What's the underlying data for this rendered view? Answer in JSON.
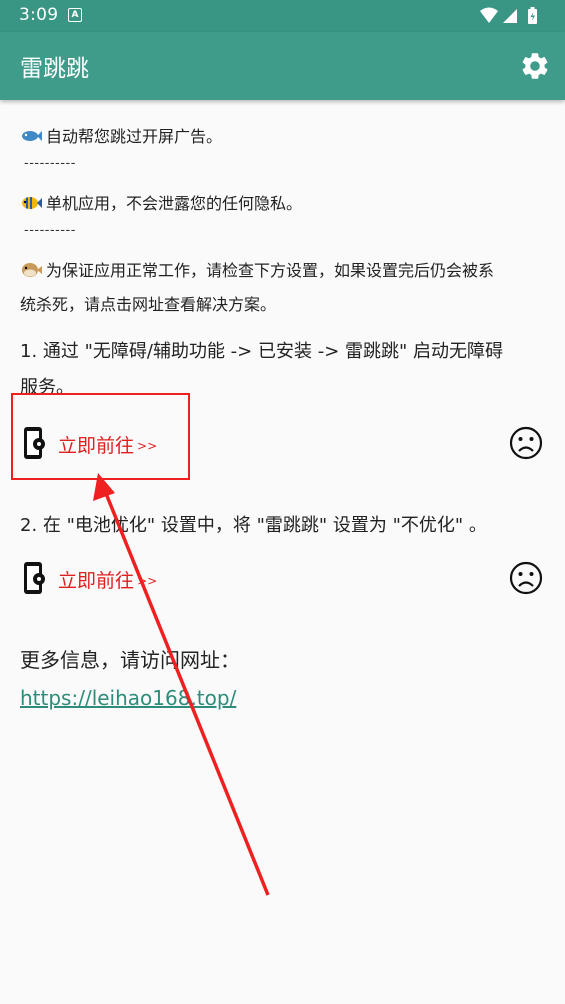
{
  "status_bar": {
    "time": "3:09",
    "notification_icon": "A"
  },
  "app_bar": {
    "title": "雷跳跳",
    "settings_icon": "gear-icon",
    "background_color": "#3f9c8a"
  },
  "intro": {
    "line1": "自动帮您跳过开屏广告。",
    "separator1": "----------",
    "line2": "单机应用，不会泄露您的任何隐私。",
    "separator2": "----------",
    "line3_part1": "为保证应用正常工作，请检查下方设置，如果设置完后仍会被系",
    "line3_part2": "统杀死，请点击网址查看解决方案。"
  },
  "steps": [
    {
      "text_line1": "1. 通过 \"无障碍/辅助功能 -> 已安装 -> 雷跳跳\" 启动无障碍",
      "text_line2": "服务。",
      "action_label": "立即前往",
      "action_arrows": ">>",
      "status_icon": "sad-face-icon"
    },
    {
      "text_line1": "2. 在 \"电池优化\" 设置中，将 \"雷跳跳\" 设置为 \"不优化\" 。",
      "action_label": "立即前往",
      "action_arrows": ">>",
      "status_icon": "sad-face-icon"
    }
  ],
  "more_info": {
    "label": "更多信息，请访问网址：",
    "url": "https://leihao168.top/"
  },
  "colors": {
    "accent": "#3f9c8a",
    "action_text": "#e02020",
    "annotation": "#ee2020"
  }
}
